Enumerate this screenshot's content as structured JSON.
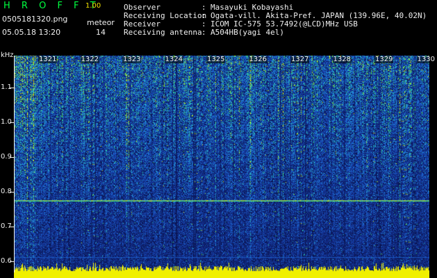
{
  "app": {
    "title": "H R O F F T",
    "version": "1.00"
  },
  "file": {
    "name": "0505181320.png",
    "datetime": "05.05.18 13:20"
  },
  "meteor": {
    "label": "meteor",
    "count": "14"
  },
  "info": [
    {
      "label": "Observer",
      "value": "Masayuki Kobayashi"
    },
    {
      "label": "Receiving Location",
      "value": "Ogata-vill. Akita-Pref. JAPAN (139.96E, 40.02N)"
    },
    {
      "label": "Receiver",
      "value": "ICOM IC-575 53.7492(@LCD)MHz USB"
    },
    {
      "label": "Receiving antenna",
      "value": "A504HB(yagi 4el)"
    }
  ],
  "axis": {
    "unit": "kHz",
    "y_ticks": [
      "1.1",
      "1.0",
      "0.9",
      "0.8",
      "0.7",
      "0.6"
    ],
    "time_ticks": [
      "1321",
      "1322",
      "1323",
      "1324",
      "1325",
      "1326",
      "1327",
      "1328",
      "1329",
      "1330"
    ]
  },
  "colors": {
    "title": "#00ff40",
    "version": "#f0e000",
    "text": "#f0f0f0",
    "spectrum_low": "#0a1850",
    "spectrum_high": "#f0f000"
  }
}
